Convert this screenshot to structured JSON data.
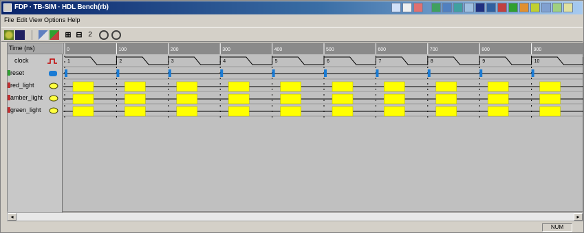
{
  "window": {
    "title": "FDP · TB-SIM · HDL Bench(rb)"
  },
  "menubar": {
    "items": [
      "File",
      "Edit",
      "View",
      "Options",
      "Help"
    ]
  },
  "toolbar": {
    "zoom_symbol_1": "⊞",
    "zoom_symbol_2": "⊟",
    "step_label": "2"
  },
  "timeline": {
    "header_label": "Time (ns)",
    "ticks": [
      "0",
      "100",
      "200",
      "300",
      "400",
      "500",
      "600",
      "700",
      "800",
      "900"
    ]
  },
  "signals": [
    {
      "name": "clock",
      "type": "clock"
    },
    {
      "name": "reset",
      "type": "reset"
    },
    {
      "name": "red_light",
      "type": "light"
    },
    {
      "name": "amber_light",
      "type": "light"
    },
    {
      "name": "green_light",
      "type": "light"
    }
  ],
  "clock_cycle_labels": [
    "1",
    "2",
    "3",
    "4",
    "5",
    "6",
    "7",
    "8",
    "9",
    "10"
  ],
  "colors": {
    "highlight": "#ffff00",
    "reset_marker": "#1a7bd4",
    "wave": "#000000",
    "titlebar": "#0a246a",
    "background": "#c0c0c0"
  },
  "status": {
    "text": "NUM"
  }
}
